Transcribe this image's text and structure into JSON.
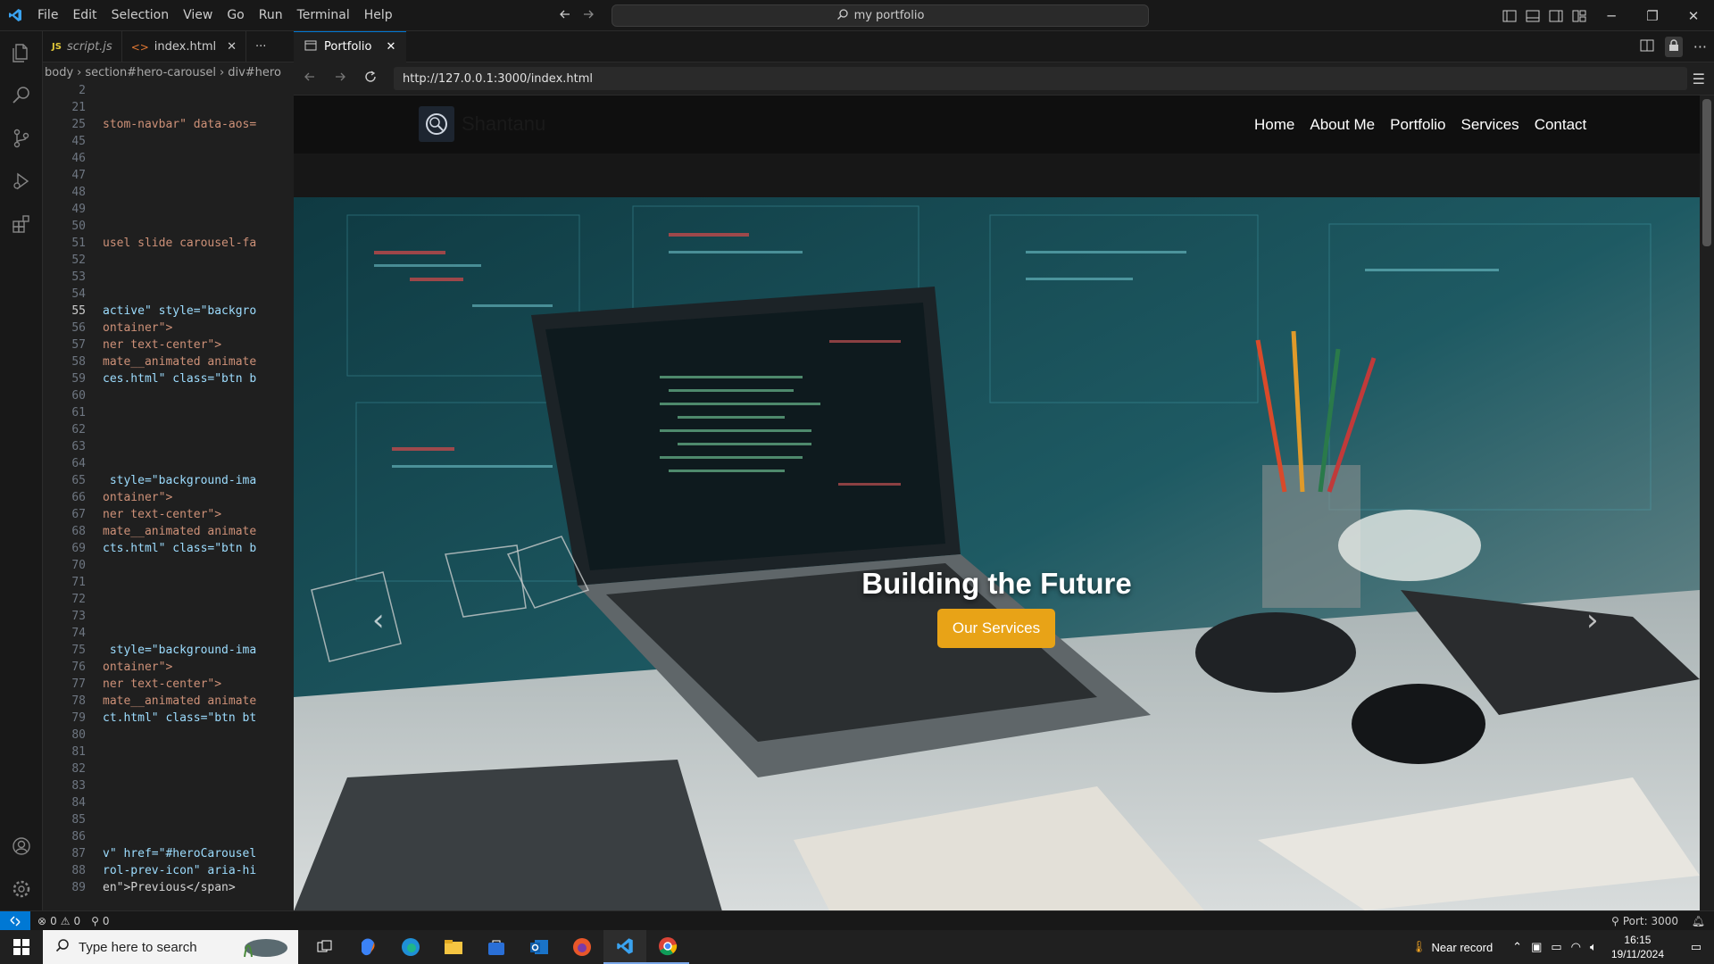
{
  "menu": [
    "File",
    "Edit",
    "Selection",
    "View",
    "Go",
    "Run",
    "Terminal",
    "Help"
  ],
  "command_center": "my portfolio",
  "editor": {
    "tabs": [
      {
        "label": "script.js",
        "icon": "JS"
      },
      {
        "label": "index.html"
      }
    ],
    "breadcrumb": [
      "body",
      "section#hero-carousel",
      "div#hero"
    ],
    "lines": [
      {
        "n": "2",
        "t": ""
      },
      {
        "n": "21",
        "t": ""
      },
      {
        "n": "25",
        "t": "stom-navbar\" data-aos="
      },
      {
        "n": "45",
        "t": ""
      },
      {
        "n": "46",
        "t": ""
      },
      {
        "n": "47",
        "t": ""
      },
      {
        "n": "48",
        "t": ""
      },
      {
        "n": "49",
        "t": ""
      },
      {
        "n": "50",
        "t": ""
      },
      {
        "n": "51",
        "t": "usel slide carousel-fa"
      },
      {
        "n": "52",
        "t": ""
      },
      {
        "n": "53",
        "t": ""
      },
      {
        "n": "54",
        "t": ""
      },
      {
        "n": "55",
        "t": "active\" style=\"backgro"
      },
      {
        "n": "56",
        "t": "ontainer\">"
      },
      {
        "n": "57",
        "t": "ner text-center\">"
      },
      {
        "n": "58",
        "t": "mate__animated animate"
      },
      {
        "n": "59",
        "t": "ces.html\" class=\"btn b"
      },
      {
        "n": "60",
        "t": ""
      },
      {
        "n": "61",
        "t": ""
      },
      {
        "n": "62",
        "t": ""
      },
      {
        "n": "63",
        "t": ""
      },
      {
        "n": "64",
        "t": ""
      },
      {
        "n": "65",
        "t": " style=\"background-ima"
      },
      {
        "n": "66",
        "t": "ontainer\">"
      },
      {
        "n": "67",
        "t": "ner text-center\">"
      },
      {
        "n": "68",
        "t": "mate__animated animate"
      },
      {
        "n": "69",
        "t": "cts.html\" class=\"btn b"
      },
      {
        "n": "70",
        "t": ""
      },
      {
        "n": "71",
        "t": ""
      },
      {
        "n": "72",
        "t": ""
      },
      {
        "n": "73",
        "t": ""
      },
      {
        "n": "74",
        "t": ""
      },
      {
        "n": "75",
        "t": " style=\"background-ima"
      },
      {
        "n": "76",
        "t": "ontainer\">"
      },
      {
        "n": "77",
        "t": "ner text-center\">"
      },
      {
        "n": "78",
        "t": "mate__animated animate"
      },
      {
        "n": "79",
        "t": "ct.html\" class=\"btn bt"
      },
      {
        "n": "80",
        "t": ""
      },
      {
        "n": "81",
        "t": ""
      },
      {
        "n": "82",
        "t": ""
      },
      {
        "n": "83",
        "t": ""
      },
      {
        "n": "84",
        "t": ""
      },
      {
        "n": "85",
        "t": ""
      },
      {
        "n": "86",
        "t": ""
      },
      {
        "n": "87",
        "t": "v\" href=\"#heroCarousel"
      },
      {
        "n": "88",
        "t": "rol-prev-icon\" aria-hi"
      },
      {
        "n": "89",
        "t": "en\">Previous</span>"
      }
    ]
  },
  "browser": {
    "tab_label": "Portfolio",
    "url": "http://127.0.0.1:3000/index.html"
  },
  "site": {
    "brand": "Shantanu",
    "nav": [
      "Home",
      "About Me",
      "Portfolio",
      "Services",
      "Contact"
    ],
    "hero_title": "Building the Future",
    "hero_button": "Our Services"
  },
  "status": {
    "errors": "0",
    "warnings": "0",
    "ports": "0",
    "port": "Port: 3000"
  },
  "taskbar": {
    "search_placeholder": "Type here to search",
    "weather": "Near record",
    "time": "16:15",
    "date": "19/11/2024"
  }
}
